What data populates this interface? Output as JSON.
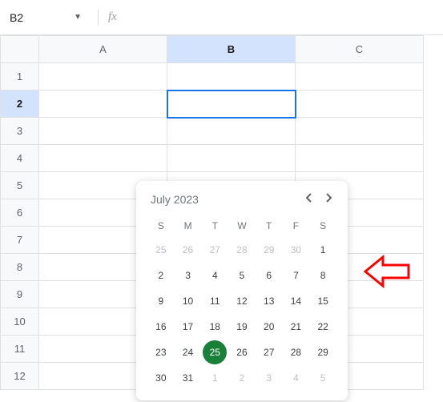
{
  "name_box": {
    "value": "B2"
  },
  "fx": {
    "label": "fx"
  },
  "columns": [
    "A",
    "B",
    "C"
  ],
  "rows": [
    "1",
    "2",
    "3",
    "4",
    "5",
    "6",
    "7",
    "8",
    "9",
    "10",
    "11",
    "12"
  ],
  "active": {
    "col": "B",
    "row": "2"
  },
  "datepicker": {
    "title": "July 2023",
    "dow": [
      "S",
      "M",
      "T",
      "W",
      "T",
      "F",
      "S"
    ],
    "weeks": [
      [
        {
          "d": "25",
          "o": true
        },
        {
          "d": "26",
          "o": true
        },
        {
          "d": "27",
          "o": true
        },
        {
          "d": "28",
          "o": true
        },
        {
          "d": "29",
          "o": true
        },
        {
          "d": "30",
          "o": true
        },
        {
          "d": "1"
        }
      ],
      [
        {
          "d": "2"
        },
        {
          "d": "3"
        },
        {
          "d": "4"
        },
        {
          "d": "5"
        },
        {
          "d": "6"
        },
        {
          "d": "7"
        },
        {
          "d": "8"
        }
      ],
      [
        {
          "d": "9"
        },
        {
          "d": "10"
        },
        {
          "d": "11"
        },
        {
          "d": "12"
        },
        {
          "d": "13"
        },
        {
          "d": "14"
        },
        {
          "d": "15"
        }
      ],
      [
        {
          "d": "16"
        },
        {
          "d": "17"
        },
        {
          "d": "18"
        },
        {
          "d": "19"
        },
        {
          "d": "20"
        },
        {
          "d": "21"
        },
        {
          "d": "22"
        }
      ],
      [
        {
          "d": "23"
        },
        {
          "d": "24"
        },
        {
          "d": "25",
          "today": true
        },
        {
          "d": "26"
        },
        {
          "d": "27"
        },
        {
          "d": "28"
        },
        {
          "d": "29"
        }
      ],
      [
        {
          "d": "30"
        },
        {
          "d": "31"
        },
        {
          "d": "1",
          "o": true
        },
        {
          "d": "2",
          "o": true
        },
        {
          "d": "3",
          "o": true
        },
        {
          "d": "4",
          "o": true
        },
        {
          "d": "5",
          "o": true
        }
      ]
    ]
  }
}
